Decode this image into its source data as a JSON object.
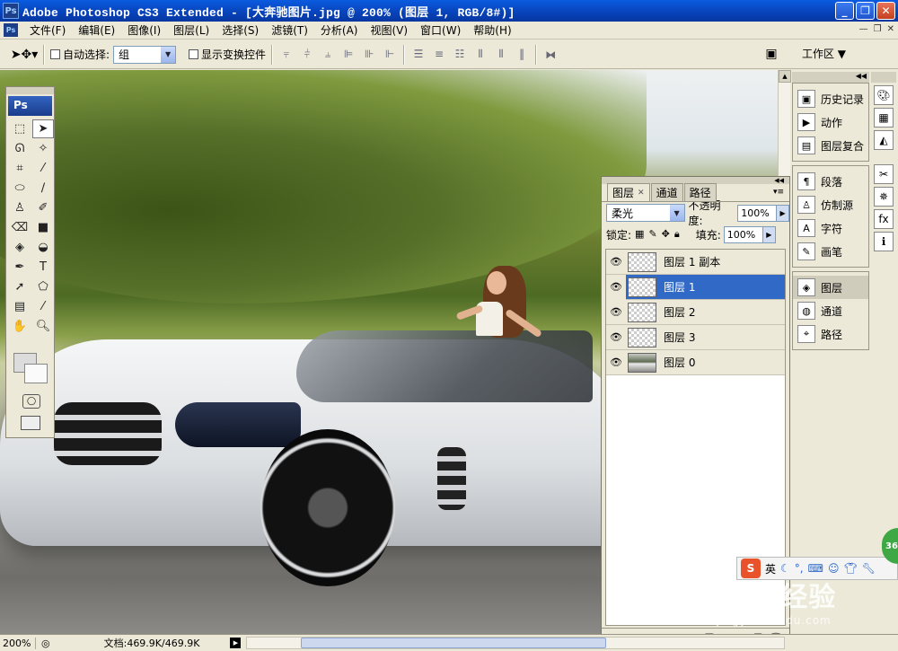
{
  "window": {
    "title": "Adobe Photoshop CS3 Extended - [大奔驰图片.jpg @ 200% (图层 1, RGB/8#)]",
    "app_icon": "Ps",
    "controls": [
      "_",
      "❐",
      "✕"
    ]
  },
  "menu": {
    "items": [
      "文件(F)",
      "编辑(E)",
      "图像(I)",
      "图层(L)",
      "选择(S)",
      "滤镜(T)",
      "分析(A)",
      "视图(V)",
      "窗口(W)",
      "帮助(H)"
    ]
  },
  "options": {
    "auto_select_label": "自动选择:",
    "auto_select_value": "组",
    "show_transform_label": "显示变换控件",
    "workspace_label": "工作区 ▼"
  },
  "toolbox": {
    "logo": "Ps"
  },
  "layers_panel": {
    "tabs": [
      "图层",
      "通道",
      "路径"
    ],
    "blend_mode": "柔光",
    "opacity_label": "不透明度:",
    "opacity_value": "100%",
    "lock_label": "锁定:",
    "fill_label": "填充:",
    "fill_value": "100%",
    "layers": [
      {
        "name": "图层 1 副本",
        "selected": false
      },
      {
        "name": "图层 1",
        "selected": true
      },
      {
        "name": "图层 2",
        "selected": false
      },
      {
        "name": "图层 3",
        "selected": false
      },
      {
        "name": "图层 0",
        "selected": false
      }
    ],
    "footer_icons": [
      "link-icon",
      "fx-icon",
      "mask-icon",
      "adjustment-icon",
      "folder-icon",
      "new-layer-icon",
      "trash-icon"
    ]
  },
  "dock": {
    "group1": [
      "历史记录",
      "动作",
      "图层复合"
    ],
    "group2": [
      "段落",
      "仿制源",
      "字符",
      "画笔"
    ],
    "group3": [
      "图层",
      "通道",
      "路径"
    ]
  },
  "status": {
    "zoom": "200%",
    "doc_info": "文档:469.9K/469.9K"
  },
  "watermark": {
    "main": "Baidu经验",
    "sub": "jingyan.baidu.com"
  },
  "ime": {
    "label": "英"
  },
  "badge": {
    "label": "36"
  },
  "colors": {
    "title_blue": "#0842b8",
    "selection_blue": "#3169c6",
    "panel_bg": "#ece9d8"
  }
}
